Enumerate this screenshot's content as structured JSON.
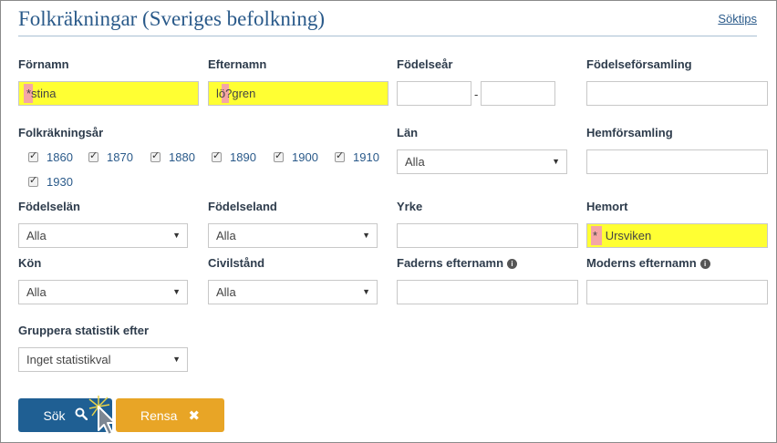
{
  "header": {
    "title": "Folkräkningar (Sveriges befolkning)",
    "tips": "Söktips"
  },
  "fields": {
    "fornamn": {
      "label": "Förnamn",
      "value": "*stina"
    },
    "efternamn": {
      "label": "Efternamn",
      "value": "lö?gren"
    },
    "fodelsear": {
      "label": "Födelseår",
      "dash": "-"
    },
    "fodelseforsamling": {
      "label": "Födelseförsamling"
    },
    "folkrakningsar": {
      "label": "Folkräkningsår",
      "years": [
        "1860",
        "1870",
        "1880",
        "1890",
        "1900",
        "1910",
        "1930"
      ]
    },
    "lan": {
      "label": "Län",
      "value": "Alla"
    },
    "hemforsamling": {
      "label": "Hemförsamling"
    },
    "fodelselan": {
      "label": "Födelselän",
      "value": "Alla"
    },
    "fodelseland": {
      "label": "Födelseland",
      "value": "Alla"
    },
    "yrke": {
      "label": "Yrke"
    },
    "hemort": {
      "label": "Hemort",
      "star": "*",
      "value": "Ursviken"
    },
    "kon": {
      "label": "Kön",
      "value": "Alla"
    },
    "civilstand": {
      "label": "Civilstånd",
      "value": "Alla"
    },
    "faderns_efternamn": {
      "label": "Faderns efternamn"
    },
    "moderns_efternamn": {
      "label": "Moderns efternamn"
    },
    "gruppera": {
      "label": "Gruppera statistik efter",
      "value": "Inget statistikval"
    }
  },
  "buttons": {
    "sok": "Sök",
    "rensa": "Rensa"
  },
  "icons": {
    "sok": "search-icon",
    "rensa": "close-icon",
    "info": "info-icon",
    "dropdown": "chevron-down-icon"
  },
  "colors": {
    "title": "#2a5a8a",
    "highlight": "#ffff33",
    "highlight_mark": "#f4a6a6",
    "sok_button": "#1f5f93",
    "rensa_button": "#e8a526"
  }
}
